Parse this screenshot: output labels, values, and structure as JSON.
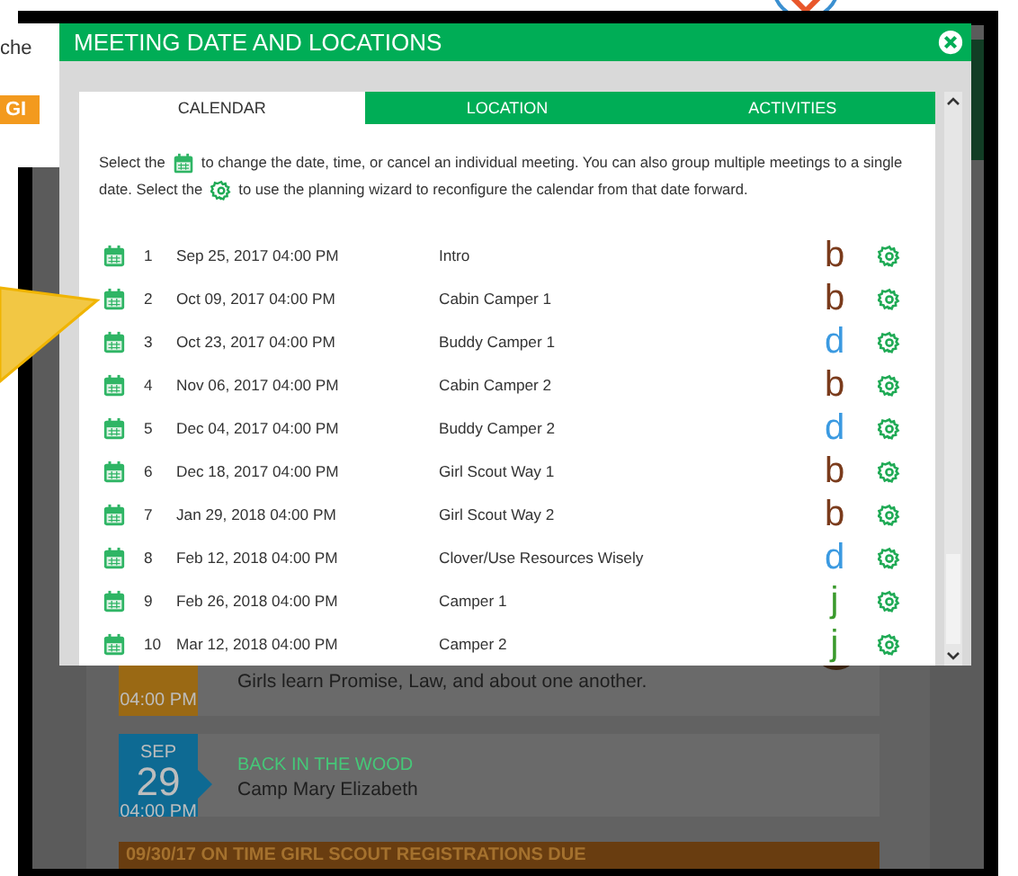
{
  "background_page": {
    "snippet": "che",
    "button": "GI",
    "events": [
      {
        "kind": "partial",
        "color": "#9a6914",
        "time": "04:00 PM",
        "description": "Girls learn Promise, Law, and about one another."
      },
      {
        "kind": "full",
        "color": "#0e6a93",
        "month": "SEP",
        "day": "29",
        "time": "04:00 PM",
        "title": "BACK IN THE WOOD",
        "description": "Camp Mary Elizabeth"
      }
    ],
    "notice": "09/30/17 ON TIME GIRL SCOUT REGISTRATIONS DUE"
  },
  "dialog": {
    "title": "MEETING DATE AND LOCATIONS",
    "tabs": [
      {
        "label": "CALENDAR",
        "selected": true
      },
      {
        "label": "LOCATION",
        "selected": false
      },
      {
        "label": "ACTIVITIES",
        "selected": false
      }
    ],
    "instructions": [
      [
        {
          "kind": "text",
          "text": "Select the"
        },
        {
          "kind": "calendar_icon"
        },
        {
          "kind": "text",
          "text": "to change the date, time, or cancel an individual meeting. You can also group multiple meetings to a single"
        }
      ],
      [
        {
          "kind": "text",
          "text": "date. Select the"
        },
        {
          "kind": "gear_icon"
        },
        {
          "kind": "text",
          "text": "to use the planning wizard to reconfigure the calendar from that date forward."
        }
      ]
    ],
    "meetings": [
      {
        "number": "1",
        "date": "Sep 25, 2017 04:00 PM",
        "name": "Intro",
        "badge": "b",
        "color": "#7a3b1c"
      },
      {
        "number": "2",
        "date": "Oct 09, 2017 04:00 PM",
        "name": "Cabin Camper 1",
        "badge": "b",
        "color": "#7a3b1c"
      },
      {
        "number": "3",
        "date": "Oct 23, 2017 04:00 PM",
        "name": "Buddy Camper 1",
        "badge": "d",
        "color": "#3b9ae1"
      },
      {
        "number": "4",
        "date": "Nov 06, 2017 04:00 PM",
        "name": "Cabin Camper 2",
        "badge": "b",
        "color": "#7a3b1c"
      },
      {
        "number": "5",
        "date": "Dec 04, 2017 04:00 PM",
        "name": "Buddy Camper 2",
        "badge": "d",
        "color": "#3b9ae1"
      },
      {
        "number": "6",
        "date": "Dec 18, 2017 04:00 PM",
        "name": "Girl Scout Way 1",
        "badge": "b",
        "color": "#7a3b1c"
      },
      {
        "number": "7",
        "date": "Jan 29, 2018 04:00 PM",
        "name": "Girl Scout Way 2",
        "badge": "b",
        "color": "#7a3b1c"
      },
      {
        "number": "8",
        "date": "Feb 12, 2018 04:00 PM",
        "name": "Clover/Use Resources Wisely",
        "badge": "d",
        "color": "#3b9ae1"
      },
      {
        "number": "9",
        "date": "Feb 26, 2018 04:00 PM",
        "name": "Camper 1",
        "badge": "j",
        "color": "#3a9a2c"
      },
      {
        "number": "10",
        "date": "Mar 12, 2018 04:00 PM",
        "name": "Camper 2",
        "badge": "j",
        "color": "#3a9a2c"
      }
    ]
  }
}
